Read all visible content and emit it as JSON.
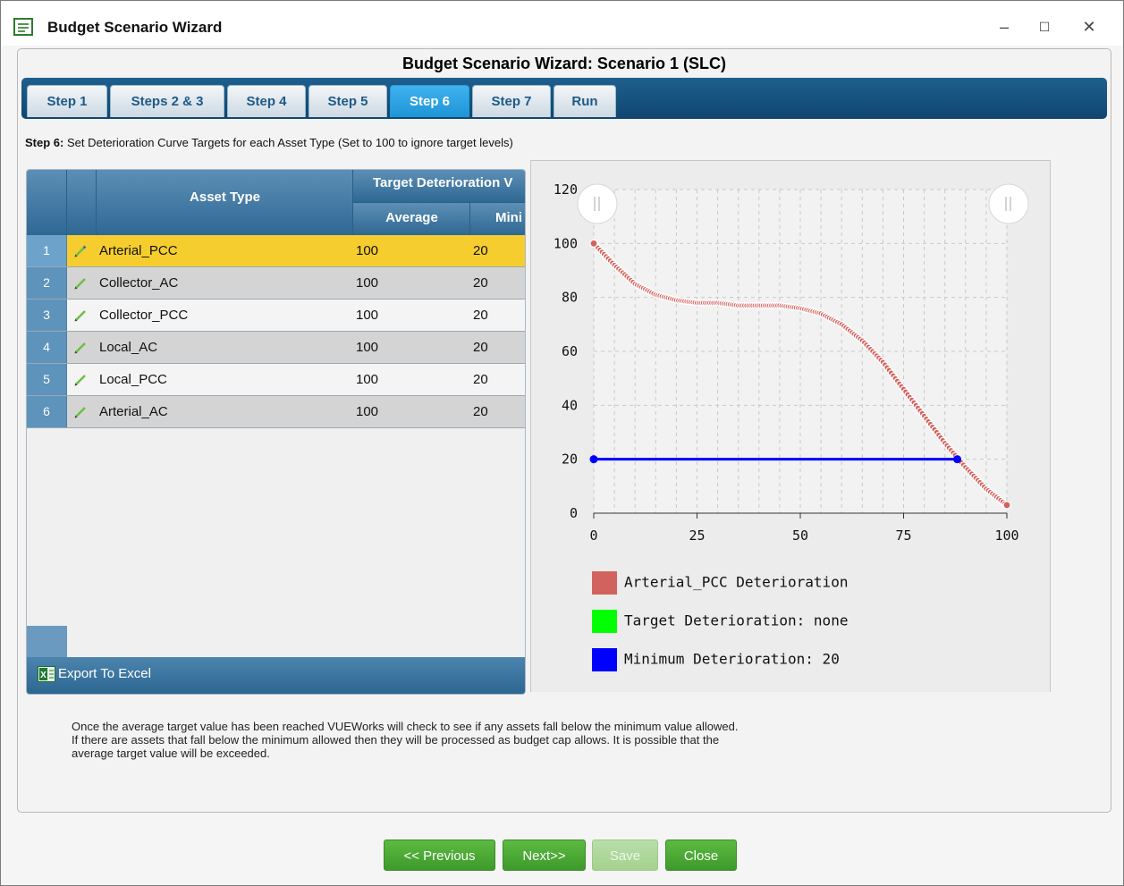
{
  "window": {
    "title": "Budget Scenario Wizard",
    "minimize": "‒",
    "maximize": "☐",
    "close": "✕"
  },
  "wizard": {
    "title": "Budget Scenario Wizard: Scenario 1 (SLC)",
    "tabs": [
      {
        "label": "Step 1"
      },
      {
        "label": "Steps 2 & 3"
      },
      {
        "label": "Step 4"
      },
      {
        "label": "Step 5"
      },
      {
        "label": "Step 6",
        "active": true
      },
      {
        "label": "Step 7"
      },
      {
        "label": "Run"
      }
    ],
    "step_label": "Step 6:",
    "step_text": "Set Deterioration Curve Targets for each Asset Type (Set to 100 to ignore target levels)"
  },
  "grid": {
    "headers": {
      "asset_type": "Asset Type",
      "target_group": "Target Deterioration V",
      "average": "Average",
      "minimum": "Mini"
    },
    "rows": [
      {
        "num": "1",
        "asset": "Arterial_PCC",
        "average": "100",
        "minimum": "20"
      },
      {
        "num": "2",
        "asset": "Collector_AC",
        "average": "100",
        "minimum": "20"
      },
      {
        "num": "3",
        "asset": "Collector_PCC",
        "average": "100",
        "minimum": "20"
      },
      {
        "num": "4",
        "asset": "Local_AC",
        "average": "100",
        "minimum": "20"
      },
      {
        "num": "5",
        "asset": "Local_PCC",
        "average": "100",
        "minimum": "20"
      },
      {
        "num": "6",
        "asset": "Arterial_AC",
        "average": "100",
        "minimum": "20"
      }
    ],
    "export_label": "Export To Excel"
  },
  "chart_data": {
    "type": "line",
    "x_ticks": [
      0,
      25,
      50,
      75,
      100
    ],
    "y_ticks": [
      0,
      20,
      40,
      60,
      80,
      100,
      120
    ],
    "xlim": [
      0,
      100
    ],
    "ylim": [
      0,
      120
    ],
    "grid": true,
    "legend_position": "bottom",
    "series": [
      {
        "name": "Arterial_PCC Deterioration",
        "color": "#d2625e",
        "style": "dotted-markers",
        "points": [
          [
            0,
            100
          ],
          [
            5,
            92
          ],
          [
            10,
            85
          ],
          [
            15,
            81
          ],
          [
            20,
            79
          ],
          [
            25,
            78
          ],
          [
            30,
            78
          ],
          [
            35,
            77
          ],
          [
            40,
            77
          ],
          [
            45,
            77
          ],
          [
            50,
            76
          ],
          [
            55,
            74
          ],
          [
            60,
            70
          ],
          [
            65,
            64
          ],
          [
            70,
            56
          ],
          [
            75,
            46
          ],
          [
            80,
            36
          ],
          [
            85,
            26
          ],
          [
            90,
            17
          ],
          [
            95,
            9
          ],
          [
            100,
            3
          ]
        ]
      },
      {
        "name": "Target Deterioration: none",
        "color": "#00ff00",
        "points": []
      },
      {
        "name": "Minimum Deterioration: 20",
        "color": "#0000ff",
        "points": [
          [
            0,
            20
          ],
          [
            88,
            20
          ]
        ]
      }
    ]
  },
  "info_text": {
    "line1": "Once the average target value has been reached VUEWorks will check to see if any assets fall below the minimum value allowed.",
    "line2": "If there are assets that fall below the minimum allowed then they will be processed as budget cap allows. It is possible that the",
    "line3": "average target value will be exceeded."
  },
  "footer": {
    "previous": "<< Previous",
    "next": "Next>>",
    "save": "Save",
    "close": "Close"
  },
  "colors": {
    "tab_active": "#1e95d8",
    "selected_row": "#f6cd2e",
    "button_green": "#4aa935"
  }
}
